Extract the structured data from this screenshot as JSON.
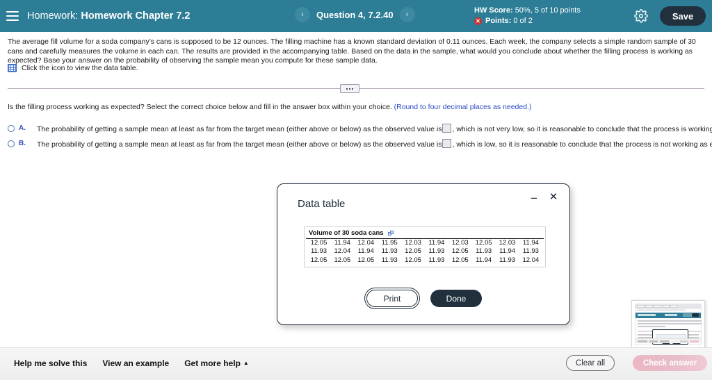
{
  "header": {
    "menu_icon": "hamburger-menu-icon",
    "label": "Homework:",
    "title": "Homework Chapter 7.2",
    "prev_arrow": "‹",
    "next_arrow": "›",
    "question_label": "Question 4, 7.2.40",
    "hw_score_label": "HW Score:",
    "hw_score_value": "50%, 5 of 10 points",
    "points_label": "Points:",
    "points_value": "0 of 2",
    "points_status_icon": "✕",
    "settings_icon": "gear-icon",
    "save_label": "Save",
    "bar_color": "#2d7d96",
    "save_color": "#22303d",
    "error_color": "#cf3232"
  },
  "question": {
    "body": "The average fill volume for a soda company's cans is supposed to be 12 ounces. The filling machine has a known standard deviation of 0.11 ounces. Each week, the company selects a simple random sample of 30 cans and carefully measures the volume in each can. The results are provided in the accompanying table. Based on the data in the sample, what would you conclude about whether the filling process is working as expected? Base your answer on the probability of observing the sample mean you compute for these sample data.",
    "data_table_link": "Click the icon to view the data table.",
    "data_table_icon": "table-grid-icon"
  },
  "divider": {
    "handle_icon": "collapse-handle-dots"
  },
  "prompt": {
    "text": "Is the filling process working as expected? Select the correct choice below and fill in the answer box within your choice.",
    "hint": "(Round to four decimal places as needed.)",
    "hint_color": "#2a49c4"
  },
  "choices": [
    {
      "letter": "A.",
      "text_before": "The probability of getting a sample mean at least as far from the target mean (either above or below) as the observed value is",
      "answer_value": "",
      "text_after": ", which is not very low, so it is reasonable to conclude that the process is working as expected.",
      "selected": false
    },
    {
      "letter": "B.",
      "text_before": "The probability of getting a sample mean at least as far from the target mean (either above or below) as the observed value is",
      "answer_value": "",
      "text_after": ", which is low, so it is reasonable to conclude that the process is not working as expected.",
      "selected": false
    }
  ],
  "modal": {
    "title": "Data table",
    "minimize_icon": "−",
    "close_icon": "✕",
    "table_caption": "Volume of 30 soda cans",
    "copy_icon": "copy-icon",
    "print_label": "Print",
    "done_label": "Done",
    "table_rows": [
      [
        "12.05",
        "11.94",
        "12.04",
        "11.95",
        "12.03",
        "11.94",
        "12.03",
        "12.05",
        "12.03",
        "11.94"
      ],
      [
        "11.93",
        "12.04",
        "11.94",
        "11.93",
        "12.05",
        "11.93",
        "12.05",
        "11.93",
        "11.94",
        "11.93"
      ],
      [
        "12.05",
        "12.05",
        "12.05",
        "11.93",
        "12.05",
        "11.93",
        "12.05",
        "11.94",
        "11.93",
        "12.04"
      ]
    ]
  },
  "thumbnail": {
    "name": "page-preview-thumbnail"
  },
  "footer": {
    "help_me_solve_this": "Help me solve this",
    "view_an_example": "View an example",
    "get_more_help": "Get more help",
    "get_more_help_caret": "▲",
    "clear_all": "Clear all",
    "check_answer": "Check answer",
    "check_answer_disabled": true
  }
}
